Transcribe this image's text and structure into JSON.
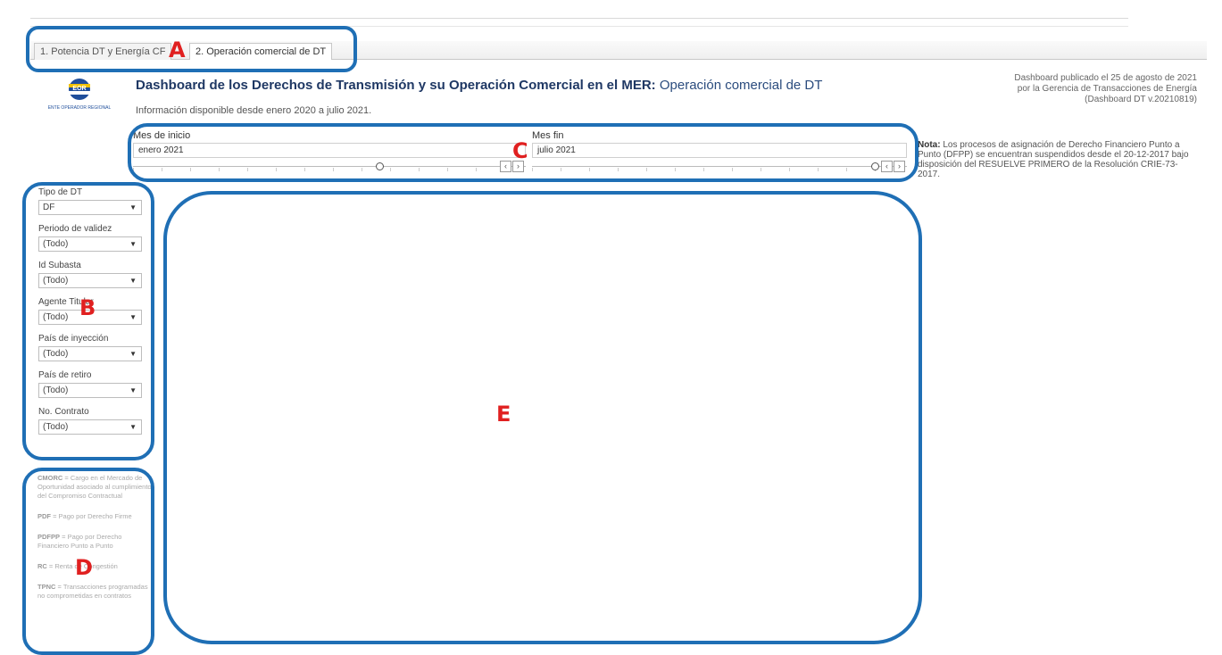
{
  "tabs": [
    {
      "label": "1. Potencia DT y Energía CF"
    },
    {
      "label": "2. Operación comercial de DT"
    }
  ],
  "logo": {
    "text": "EOR",
    "caption": "ENTE OPERADOR REGIONAL"
  },
  "header": {
    "title_bold": "Dashboard de los Derechos de Transmisión y su Operación Comercial en el MER:",
    "title_sub": "Operación comercial de DT",
    "info": "Información disponible desde enero 2020 a julio 2021.",
    "published": [
      "Dashboard publicado el 25 de agosto de 2021",
      "por la Gerencia de Transacciones de Energía",
      "(Dashboard DT v.20210819)"
    ]
  },
  "date_range": {
    "start_label": "Mes de inicio",
    "start_value": "enero 2021",
    "end_label": "Mes fin",
    "end_value": "julio 2021"
  },
  "nota": {
    "bold": "Nota:",
    "text": "Los procesos de asignación de Derecho Financiero Punto a Punto (DFPP) se encuentran suspendidos desde el 20-12-2017 bajo disposición del RESUELVE PRIMERO de la Resolución CRIE-73-2017."
  },
  "filters": [
    {
      "label": "Tipo de DT",
      "value": "DF"
    },
    {
      "label": "Periodo de validez",
      "value": "(Todo)"
    },
    {
      "label": "Id Subasta",
      "value": "(Todo)"
    },
    {
      "label": "Agente Titular",
      "value": "(Todo)"
    },
    {
      "label": "País de inyección",
      "value": "(Todo)"
    },
    {
      "label": "País de retiro",
      "value": "(Todo)"
    },
    {
      "label": "No. Contrato",
      "value": "(Todo)"
    }
  ],
  "glossary": [
    {
      "term": "CMORC",
      "desc": " = Cargo en el Mercado de Oportunidad asociado al cumplimiento del Compromiso Contractual"
    },
    {
      "term": "PDF",
      "desc": " = Pago por Derecho Firme"
    },
    {
      "term": "PDFPP",
      "desc": " = Pago por Derecho Financiero Punto a Punto"
    },
    {
      "term": "RC",
      "desc": " = Renta de Congestión"
    },
    {
      "term": "TPNC",
      "desc": " = Transacciones programadas no comprometidas en contratos"
    }
  ],
  "markers": {
    "a": "A",
    "b": "B",
    "c": "C",
    "d": "D",
    "e": "E"
  },
  "colors": {
    "annotation_box": "#1f6fb5",
    "marker": "#e02020",
    "title": "#1f3864"
  },
  "icons": {
    "dropdown": "caret-down-icon",
    "prev": "chevron-left-icon",
    "next": "chevron-right-icon"
  }
}
